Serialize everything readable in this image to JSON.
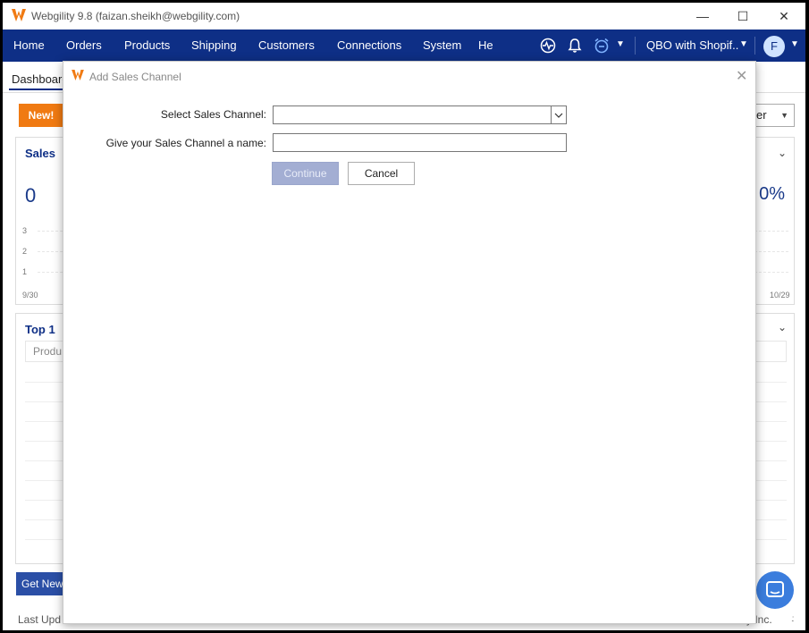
{
  "window": {
    "title": "Webgility 9.8 (faizan.sheikh@webgility.com)",
    "minimize_glyph": "—",
    "maximize_glyph": "☐",
    "close_glyph": "✕"
  },
  "nav": {
    "items": [
      "Home",
      "Orders",
      "Products",
      "Shipping",
      "Customers",
      "Connections",
      "System",
      "He"
    ],
    "icons": [
      "activity-icon",
      "bell-icon",
      "alarm-clock-icon"
    ],
    "store_label": "QBO with Shopif..",
    "avatar_letter": "F"
  },
  "dashboard": {
    "tab_label": "Dashboard",
    "new_button": "New!",
    "filter_value": "er",
    "sales_title": "Sales",
    "sales_value": "0",
    "sales_percent": "0%",
    "y_ticks": [
      "3",
      "2",
      "1"
    ],
    "x_start": "9/30",
    "x_end": "10/29",
    "top_title": "Top 1",
    "top_header": "Produ",
    "get_new_button": "Get New",
    "footer_left": "Last Upd",
    "footer_right": "ity Inc."
  },
  "modal": {
    "title": "Add Sales Channel",
    "select_label": "Select Sales Channel:",
    "select_value": "",
    "name_label": "Give your Sales Channel a name:",
    "name_value": "",
    "continue_label": "Continue",
    "cancel_label": "Cancel"
  },
  "colors": {
    "nav_bg": "#0e2f86",
    "accent_orange": "#f07a12",
    "continue_disabled": "#a3aed3"
  }
}
